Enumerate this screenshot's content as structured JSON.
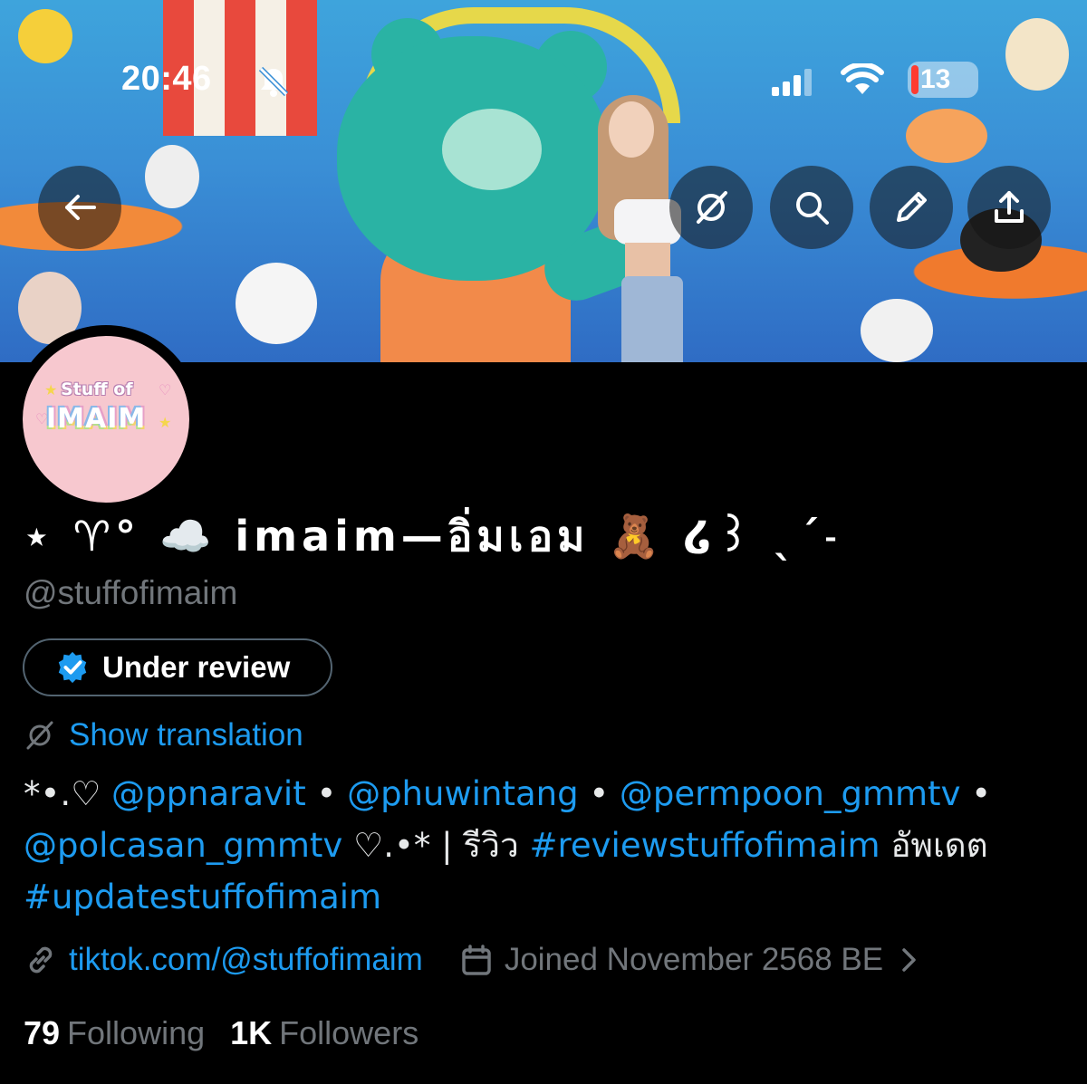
{
  "status_bar": {
    "time": "20:46",
    "battery": "13",
    "battery_color": "#ff3b30",
    "icons": [
      "bell-slash-icon",
      "signal-icon",
      "wifi-icon",
      "battery-icon"
    ]
  },
  "nav": {
    "buttons": [
      "back-arrow-icon",
      "translate-icon",
      "search-icon",
      "edit-pencil-icon",
      "share-upload-icon"
    ]
  },
  "avatar": {
    "logo_top": "Stuff of",
    "logo_main": "IMAIM"
  },
  "profile": {
    "display_name": "⋆ ♈︎° ☁️ imaim—อิ่มเอม 🧸 ໒꒱ ˎˊ˗",
    "handle": "@stuffofimaim",
    "badge_label": "Under review",
    "show_translation": "Show translation",
    "bio": {
      "p1": "*•.♡ ",
      "m1": "@ppnaravit",
      "s1": " • ",
      "m2": "@phuwintang",
      "s2": " • ",
      "m3": "@permpoon_gmmtv",
      "s3": " •",
      "m4": "@polcasan_gmmtv",
      "p2": " ♡.•* | รีวิว ",
      "h1": "#reviewstuffofimaim",
      "p3": " อัพเดต",
      "h2": "#updatestuffofimaim"
    },
    "website": "tiktok.com/@stuffofimaim",
    "joined": "Joined November 2568 BE",
    "following_count": "79",
    "following_label": "Following",
    "followers_count": "1K",
    "followers_label": "Followers"
  },
  "colors": {
    "background": "#000000",
    "link": "#1d9bf0",
    "muted": "#71767b",
    "badge_border": "#536471"
  }
}
